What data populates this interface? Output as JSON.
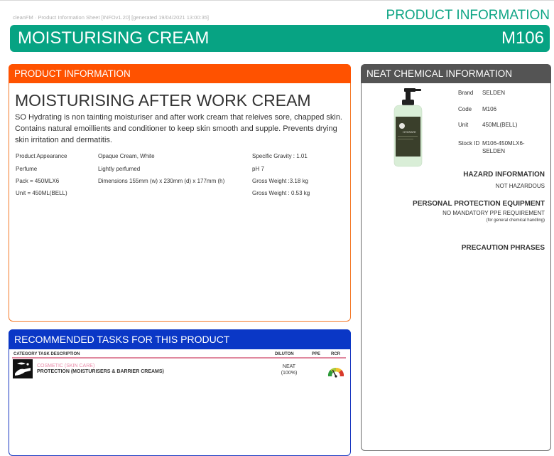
{
  "header": {
    "meta": "cleanFM · Product Information Sheet [INFOv1.20]   [generated 19/04/2021 13:00:35]",
    "doc_title": "PRODUCT INFORMATION",
    "product_name": "MOISTURISING CREAM",
    "product_code": "M106"
  },
  "product_info": {
    "heading": "PRODUCT INFORMATION",
    "title": "MOISTURISING AFTER WORK CREAM",
    "description": "SO Hydrating is non tainting moisturiser and after work cream that releives sore, chapped skin. Contains natural emoillients and conditioner to keep skin smooth and supple. Prevents drying skin irritation and dermatitis.",
    "attributes": [
      [
        "Product Appearance",
        "Opaque Cream, White",
        "Specific Gravity : 1.01"
      ],
      [
        "Perfume",
        "Lightly perfumed",
        "pH 7"
      ],
      [
        "Pack = 450MLX6",
        "Dimensions 155mm (w) x 230mm (d) x 177mm (h)",
        "Gross Weight :3.18 kg"
      ],
      [
        "Unit = 450ML(BELL)",
        "",
        "Gross Weight : 0.53 kg"
      ]
    ]
  },
  "neat": {
    "heading": "NEAT CHEMICAL INFORMATION",
    "details": [
      {
        "k": "Brand",
        "v": "SELDEN"
      },
      {
        "k": "Code",
        "v": "M106"
      },
      {
        "k": "Unit",
        "v": "450ML(BELL)"
      },
      {
        "k": "Stock ID",
        "v": "M106-450MLX6-SELDEN"
      }
    ],
    "hazard_heading": "HAZARD INFORMATION",
    "hazard_text": "NOT HAZARDOUS",
    "ppe_heading": "PERSONAL PROTECTION EQUIPMENT",
    "ppe_text": "NO MANDATORY PPE REQUIREMENT",
    "ppe_sub": "(for general chemical handling)",
    "precaution_heading": "PRECAUTION PHRASES",
    "bottle_label": "HYDRATE"
  },
  "tasks": {
    "heading": "RECOMMENDED TASKS FOR THIS PRODUCT",
    "columns": {
      "category": "CATEGORY TASK DESCRIPTION",
      "dilution": "DILUTON",
      "ppe": "PPE",
      "rcr": "RCR"
    },
    "rows": [
      {
        "category": "COSMETIC (SKIN CARE)",
        "task": "PROTECTION (MOISTURISERS & BARRIER CREAMS)",
        "dilution": "NEAT",
        "dilution_pct": "(100%)"
      }
    ]
  },
  "colors": {
    "brand_green": "#07a383",
    "info_orange": "#ff5200",
    "neat_grey": "#545454",
    "tasks_blue": "#0a37c6",
    "category_pink": "#e88aa8"
  }
}
